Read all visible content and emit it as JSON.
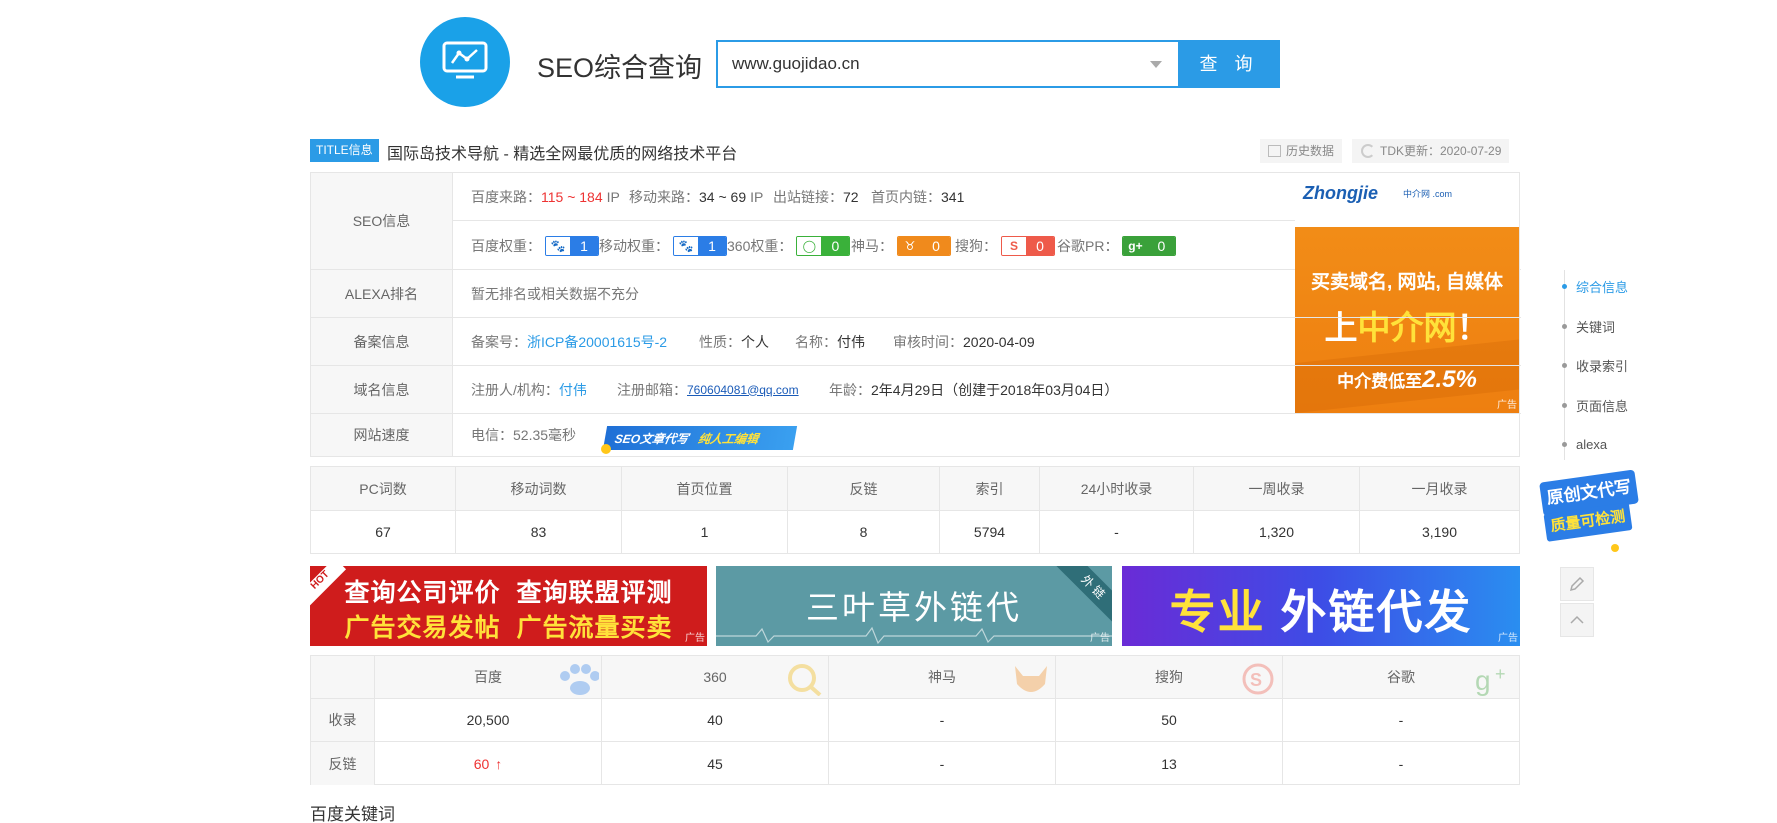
{
  "header": {
    "site_title": "SEO综合查询",
    "search_value": "www.guojidao.cn",
    "search_button": "查 询"
  },
  "title_row": {
    "tag": "TITLE信息",
    "title": "国际岛技术导航 - 精选全网最优质的网络技术平台",
    "history_btn": "历史数据",
    "tdk_update": "TDK更新：2020-07-29"
  },
  "seo_info": {
    "label": "SEO信息",
    "baidu_traffic_label": "百度来路：",
    "baidu_traffic_value": "115 ~ 184",
    "baidu_traffic_unit": "IP",
    "mobile_traffic_label": "移动来路：",
    "mobile_traffic_value": "34 ~ 69",
    "mobile_traffic_unit": "IP",
    "outbound_label": "出站链接：",
    "outbound_value": "72",
    "homepage_links_label": "首页内链：",
    "homepage_links_value": "341",
    "ranks": [
      {
        "label": "百度权重：",
        "value": "1",
        "icon": "baidu-paw"
      },
      {
        "label": "移动权重：",
        "value": "1",
        "icon": "baidu-paw"
      },
      {
        "label": "360权重：",
        "value": "0",
        "icon": "360-logo"
      },
      {
        "label": "神马：",
        "value": "0",
        "icon": "shenma-logo"
      },
      {
        "label": "搜狗：",
        "value": "0",
        "icon": "sogou-logo"
      },
      {
        "label": "谷歌PR：",
        "value": "0",
        "icon": "google-plus"
      }
    ]
  },
  "alexa": {
    "label": "ALEXA排名",
    "value": "暂无排名或相关数据不充分"
  },
  "beian": {
    "label": "备案信息",
    "number_label": "备案号：",
    "number_value": "浙ICP备20001615号-2",
    "nature_label": "性质：",
    "nature_value": "个人",
    "name_label": "名称：",
    "name_value": "付伟",
    "audit_label": "审核时间：",
    "audit_value": "2020-04-09"
  },
  "domain": {
    "label": "域名信息",
    "registrant_label": "注册人/机构：",
    "registrant_value": "付伟",
    "email_label": "注册邮箱：",
    "email_value": "760604081@qq.com",
    "age_label": "年龄：",
    "age_value": "2年4月29日（创建于2018年03月04日）"
  },
  "speed": {
    "label": "网站速度",
    "value": "电信：52.35毫秒",
    "promo_a": "SEO文章代写",
    "promo_b": "纯人工编辑"
  },
  "side_ad": {
    "logo": "Zhongjie",
    "logo_sub": "中介网 .com",
    "line1": "买卖域名, 网站, 自媒体",
    "line2_a": "上",
    "line2_b": "中介网",
    "line2_c": "！",
    "line3_a": "中介费低至",
    "line3_b": "2.5%",
    "tag": "广告"
  },
  "stats": {
    "headers": [
      "PC词数",
      "移动词数",
      "首页位置",
      "反链",
      "索引",
      "24小时收录",
      "一周收录",
      "一月收录"
    ],
    "values": [
      "67",
      "83",
      "1",
      "8",
      "5794",
      "-",
      "1,320",
      "3,190"
    ]
  },
  "banners": {
    "b1_line1_a": "查询公司评价",
    "b1_line1_b": "查询联盟评测",
    "b1_line2_a": "广告交易发帖",
    "b1_line2_b": "广告流量买卖",
    "b1_hot": "HOT",
    "b2_text": "三叶草外链代",
    "b2_corner": "外 链",
    "b3_text_a": "专业",
    "b3_text_b": "外链代发",
    "tag": "广告"
  },
  "engines": {
    "headers": [
      "百度",
      "360",
      "神马",
      "搜狗",
      "谷歌"
    ],
    "row_labels": [
      "收录",
      "反链"
    ],
    "index_values": [
      "20,500",
      "40",
      "-",
      "50",
      "-"
    ],
    "backlink_values": [
      "60",
      "45",
      "-",
      "13",
      "-"
    ],
    "baidu_backlink_arrow": "↑"
  },
  "section_title": "百度关键词",
  "right_nav": {
    "items": [
      "综合信息",
      "关键词",
      "收录索引",
      "页面信息",
      "alexa"
    ],
    "badge_line1": "原创文代写",
    "badge_line2": "质量可检测"
  },
  "colors": {
    "accent": "#2b9be6",
    "red": "#e33333",
    "orange_ad": "#f08a1c"
  }
}
